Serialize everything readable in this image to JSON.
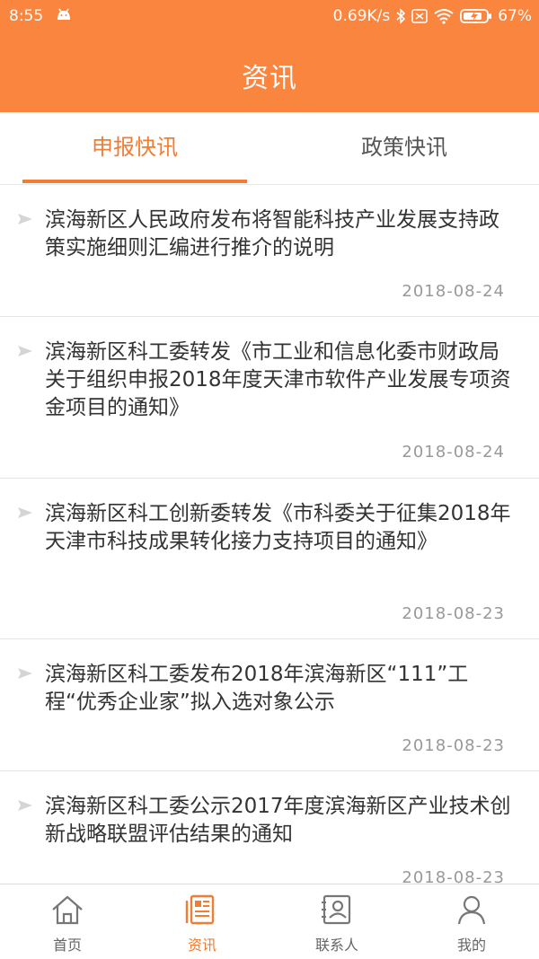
{
  "status_bar": {
    "time": "8:55",
    "speed": "0.69K/s",
    "battery": "67%"
  },
  "header": {
    "title": "资讯"
  },
  "tabs": [
    {
      "label": "申报快讯",
      "active": true
    },
    {
      "label": "政策快讯",
      "active": false
    }
  ],
  "news": [
    {
      "title": "滨海新区人民政府发布将智能科技产业发展支持政策实施细则汇编进行推介的说明",
      "date": "2018-08-24"
    },
    {
      "title": "滨海新区科工委转发《市工业和信息化委市财政局关于组织申报2018年度天津市软件产业发展专项资金项目的通知》",
      "date": "2018-08-24"
    },
    {
      "title": "滨海新区科工创新委转发《市科委关于征集2018年天津市科技成果转化接力支持项目的通知》",
      "date": "2018-08-23"
    },
    {
      "title": "滨海新区科工委发布2018年滨海新区“111”工程“优秀企业家”拟入选对象公示",
      "date": "2018-08-23"
    },
    {
      "title": "滨海新区科工委公示2017年度滨海新区产业技术创新战略联盟评估结果的通知",
      "date": "2018-08-23"
    }
  ],
  "bottom_nav": [
    {
      "label": "首页",
      "icon": "home-icon",
      "active": false
    },
    {
      "label": "资讯",
      "icon": "news-icon",
      "active": true
    },
    {
      "label": "联系人",
      "icon": "contacts-icon",
      "active": false
    },
    {
      "label": "我的",
      "icon": "profile-icon",
      "active": false
    }
  ],
  "colors": {
    "accent": "#fa853f",
    "active_text": "#f07d34"
  }
}
